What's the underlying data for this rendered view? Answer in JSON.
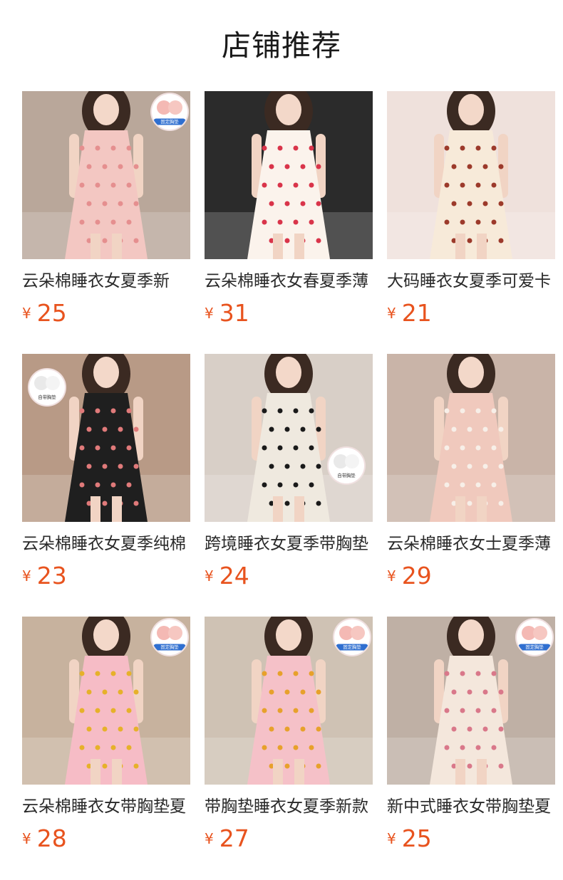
{
  "header": {
    "title": "店铺推荐"
  },
  "currency": "¥",
  "products": [
    {
      "title": "云朵棉睡衣女夏季新",
      "price": "25",
      "badge": "固定胸垫",
      "bg": "#b9a79a",
      "dress": "#f3c7c2",
      "accent": "#e58f8f",
      "icon": "nightdress-image"
    },
    {
      "title": "云朵棉睡衣女春夏季薄",
      "price": "31",
      "badge": "",
      "bg": "#2b2b2b",
      "dress": "#fbf3ec",
      "accent": "#d9344a",
      "icon": "pajama-set-image"
    },
    {
      "title": "大码睡衣女夏季可爱卡",
      "price": "21",
      "badge": "",
      "bg": "#efe1dc",
      "dress": "#f7ead9",
      "accent": "#9c3a2b",
      "icon": "tshirt-dress-image"
    },
    {
      "title": "云朵棉睡衣女夏季纯棉",
      "price": "23",
      "badge": "自带胸垫",
      "bg": "#b89a86",
      "dress": "#1f1f1f",
      "accent": "#e07a7a",
      "icon": "black-slip-dress-image"
    },
    {
      "title": "跨境睡衣女夏季带胸垫",
      "price": "24",
      "badge": "自带胸垫",
      "bg": "#d8cfc7",
      "dress": "#efe9df",
      "accent": "#1a1a1a",
      "icon": "print-dress-image"
    },
    {
      "title": "云朵棉睡衣女士夏季薄",
      "price": "29",
      "badge": "",
      "bg": "#c9b4a8",
      "dress": "#f0c9bd",
      "accent": "#f7efe8",
      "icon": "long-nightgown-image"
    },
    {
      "title": "云朵棉睡衣女带胸垫夏",
      "price": "28",
      "badge": "固定胸垫",
      "bg": "#c7b29e",
      "dress": "#f6bcc6",
      "accent": "#e6b12a",
      "icon": "pink-cami-set-image"
    },
    {
      "title": "带胸垫睡衣女夏季新款",
      "price": "27",
      "badge": "固定胸垫",
      "bg": "#cfc2b4",
      "dress": "#f5c1c8",
      "accent": "#e7a12b",
      "icon": "pink-slip-dress-image"
    },
    {
      "title": "新中式睡衣女带胸垫夏",
      "price": "25",
      "badge": "固定胸垫",
      "bg": "#bfb0a5",
      "dress": "#f4e7dc",
      "accent": "#d9788a",
      "icon": "floral-dress-image"
    }
  ]
}
